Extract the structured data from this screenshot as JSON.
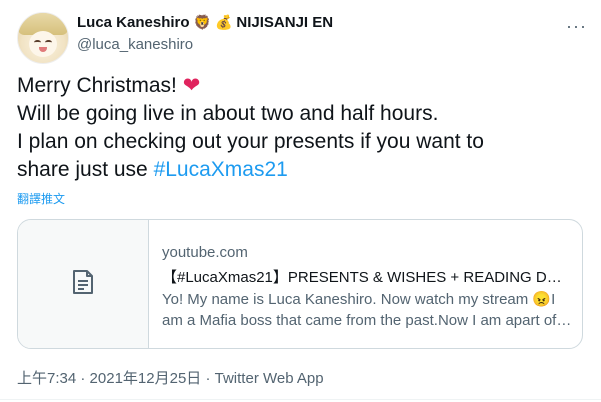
{
  "author": {
    "display_name": "Luca Kaneshiro",
    "emoji_1": "🦁",
    "emoji_2": "💰",
    "affiliation": "NIJISANJI EN",
    "handle": "@luca_kaneshiro"
  },
  "more_label": "···",
  "tweet": {
    "line1": "Merry Christmas! ",
    "heart": "❤",
    "line2": "Will be going live in about two and half hours.",
    "line3": "I plan on checking out your presents if you want to",
    "line4_prefix": "share just use ",
    "hashtag": "#LucaXmas21",
    "translate_label": "翻譯推文"
  },
  "card": {
    "domain": "youtube.com",
    "title": "【#LucaXmas21】PRESENTS & WISHES + READING DON…",
    "description": "Yo! My name is Luca Kaneshiro. Now watch my stream 😠I am a Mafia boss that came from the past.Now I am apart of…",
    "thumb_icon": "document-icon"
  },
  "meta": {
    "time": "上午7:34",
    "date": "2021年12月25日",
    "source": "Twitter Web App",
    "sep": " · "
  },
  "colors": {
    "link": "#1d9bf0",
    "heart": "#e0245e",
    "muted": "#536471",
    "border": "#cfd9de"
  }
}
